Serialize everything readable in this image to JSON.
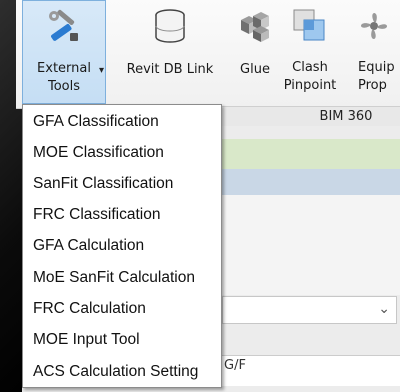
{
  "ribbon": {
    "buttons": [
      {
        "label": "External\nTools",
        "line1": "External",
        "line2": "Tools"
      },
      {
        "label": "Revit DB Link"
      },
      {
        "label": "Glue"
      },
      {
        "label": "Clash Pinpoint",
        "line1": "Clash",
        "line2": "Pinpoint"
      },
      {
        "label": "Equip Prop",
        "line1": "Equip",
        "line2": "Prop"
      }
    ],
    "group_label": "BIM 360",
    "dropdown_caret": "▾"
  },
  "menu": {
    "items": [
      "GFA Classification",
      "MOE Classification",
      "SanFit Classification",
      "FRC Classification",
      "GFA Calculation",
      "MoE SanFit Calculation",
      "FRC Calculation",
      "MOE Input Tool",
      "ACS Calculation Setting"
    ]
  },
  "background": {
    "combo_chevron": "⌄",
    "address_text": "G/F"
  },
  "colors": {
    "active_button_bg": "#c5def4",
    "active_button_border": "#7eb0dd",
    "menu_bg": "#ffffff"
  },
  "icons": [
    "tools-icon",
    "database-icon",
    "glue-cubes-icon",
    "clash-pinpoint-icon",
    "fan-icon"
  ]
}
